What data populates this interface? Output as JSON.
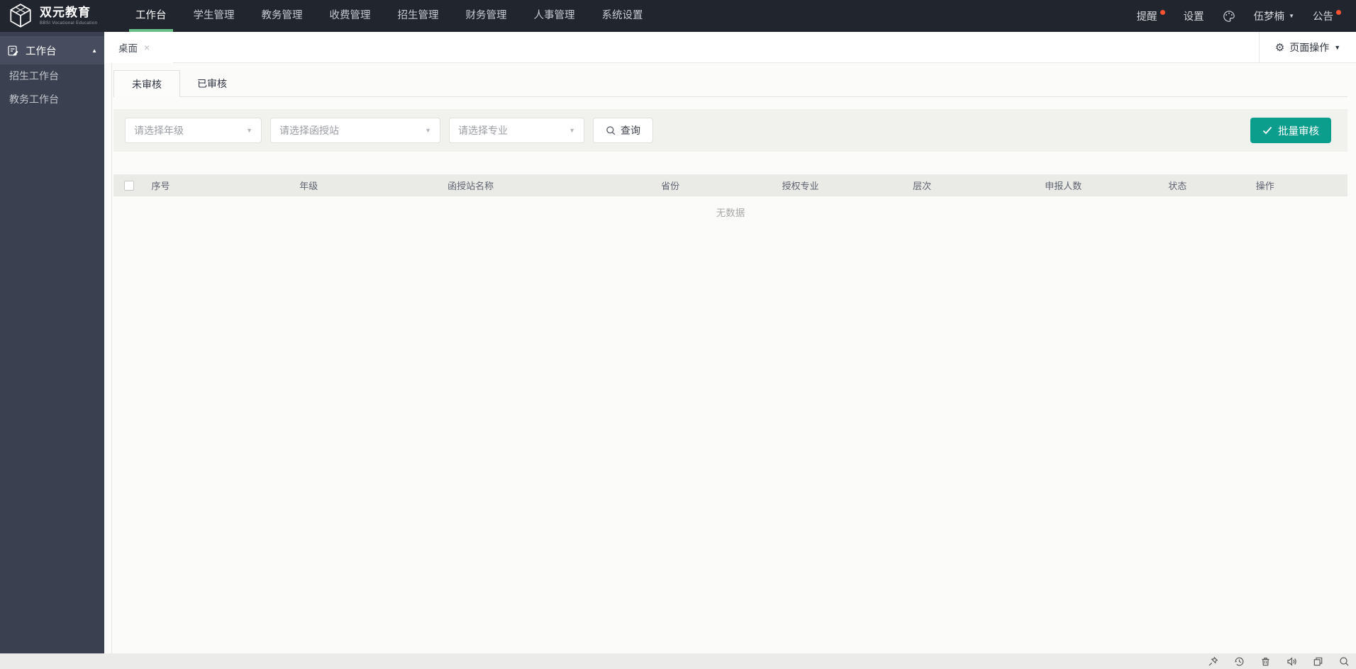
{
  "navbar": {
    "logo": {
      "title": "双元教育",
      "subtitle": "BBSI Vocational Education"
    },
    "menu": [
      "工作台",
      "学生管理",
      "教务管理",
      "收费管理",
      "招生管理",
      "财务管理",
      "人事管理",
      "系统设置"
    ],
    "active_menu": "工作台",
    "right": {
      "notice": "提醒",
      "settings": "设置",
      "username": "伍梦楠",
      "announcement": "公告"
    }
  },
  "sidebar": {
    "header": "工作台",
    "items": [
      {
        "label": "招生工作台"
      },
      {
        "label": "教务工作台"
      }
    ]
  },
  "tabbar": {
    "tabs": [
      {
        "label": "桌面"
      }
    ],
    "page_actions": "页面操作"
  },
  "main": {
    "tabs": [
      {
        "label": "未审核"
      },
      {
        "label": "已审核"
      }
    ],
    "active_tab": "未审核",
    "filters": {
      "grade_placeholder": "请选择年级",
      "station_placeholder": "请选择函授站",
      "major_placeholder": "请选择专业",
      "search_label": "查询",
      "batch_audit_label": "批量审核"
    },
    "table": {
      "columns": [
        "序号",
        "年级",
        "函授站名称",
        "省份",
        "授权专业",
        "层次",
        "申报人数",
        "状态",
        "操作"
      ],
      "rows": [],
      "empty_text": "无数据"
    }
  },
  "colors": {
    "navbar_bg": "#21252e",
    "sidebar_bg": "#3a4050",
    "accent_green": "#68c087",
    "button_teal": "#0b9e8d",
    "notification_dot": "#ff5233"
  }
}
